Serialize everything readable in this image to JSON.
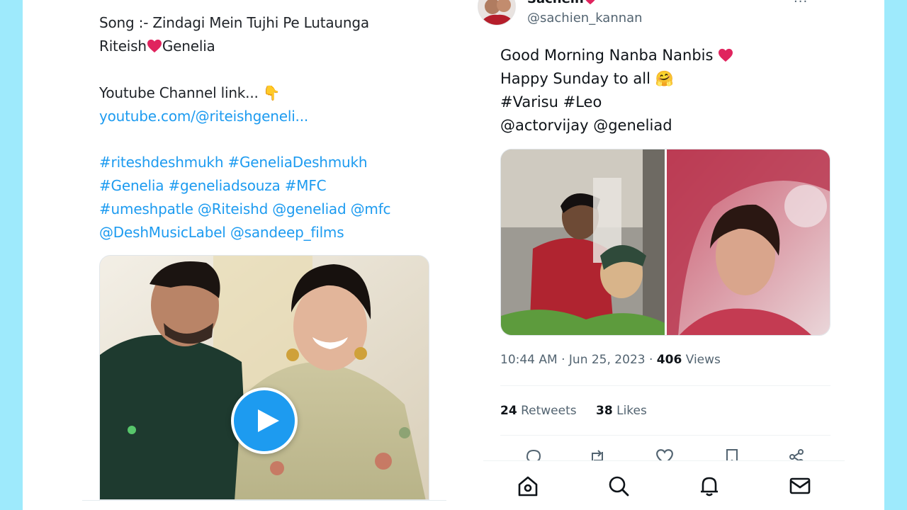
{
  "left_tweet": {
    "song_line": "Song :- Zindagi Mein Tujhi Pe Lutaunga",
    "names": {
      "first": "Riteish",
      "second": "Genelia"
    },
    "channel_label": "Youtube Channel link...",
    "channel_emoji": "👇",
    "channel_url": "youtube.com/@riteishgeneli...",
    "hashtag_lines": [
      "#riteshdeshmukh #GeneliaDeshmukh",
      "#Genelia #geneliadsouza #MFC",
      "#umeshpatle @Riteishd @geneliad @mfc",
      "@DeshMusicLabel @sandeep_films"
    ],
    "media_type": "video"
  },
  "right_tweet": {
    "display_name": "Sachein",
    "handle": "@sachien_kannan",
    "more_glyph": "···",
    "text_line1": "Good Morning Nanba Nanbis",
    "text_line2": "Happy Sunday to all",
    "hug_emoji": "🤗",
    "hashtags": "#Varisu #Leo",
    "mentions": "@actorvijay @geneliad",
    "time": "10:44 AM · Jun 25, 2023 · ",
    "views_count": "406",
    "views_label": "Views",
    "retweets_count": "24",
    "retweets_label": "Retweets",
    "likes_count": "38",
    "likes_label": "Likes"
  },
  "bottom_nav": {
    "items": [
      "home-icon",
      "search-icon",
      "notifications-icon",
      "messages-icon"
    ]
  },
  "colors": {
    "background": "#9eeafc",
    "link": "#1d9bf0",
    "heart": "#e0245e",
    "secondary_text": "#536471"
  }
}
